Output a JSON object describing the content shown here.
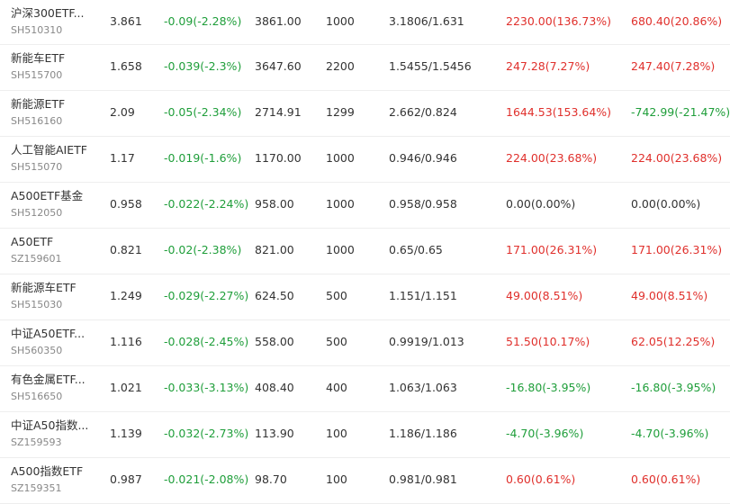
{
  "colors": {
    "up": "#e0302c",
    "down": "#1f9e3a",
    "flat": "#333333"
  },
  "rows": [
    {
      "name": "沪深300ETF...",
      "code": "SH510310",
      "price": "3.861",
      "change": "-0.09(-2.28%)",
      "value": "3861.00",
      "qty": "1000",
      "cost": "3.1806/1.631",
      "pnl1": "2230.00(136.73%)",
      "pnl1_dir": "up",
      "pnl2": "680.40(20.86%)",
      "pnl2_dir": "up"
    },
    {
      "name": "新能车ETF",
      "code": "SH515700",
      "price": "1.658",
      "change": "-0.039(-2.3%)",
      "value": "3647.60",
      "qty": "2200",
      "cost": "1.5455/1.5456",
      "pnl1": "247.28(7.27%)",
      "pnl1_dir": "up",
      "pnl2": "247.40(7.28%)",
      "pnl2_dir": "up"
    },
    {
      "name": "新能源ETF",
      "code": "SH516160",
      "price": "2.09",
      "change": "-0.05(-2.34%)",
      "value": "2714.91",
      "qty": "1299",
      "cost": "2.662/0.824",
      "pnl1": "1644.53(153.64%)",
      "pnl1_dir": "up",
      "pnl2": "-742.99(-21.47%)",
      "pnl2_dir": "down"
    },
    {
      "name": "人工智能AIETF",
      "code": "SH515070",
      "price": "1.17",
      "change": "-0.019(-1.6%)",
      "value": "1170.00",
      "qty": "1000",
      "cost": "0.946/0.946",
      "pnl1": "224.00(23.68%)",
      "pnl1_dir": "up",
      "pnl2": "224.00(23.68%)",
      "pnl2_dir": "up"
    },
    {
      "name": "A500ETF基金",
      "code": "SH512050",
      "price": "0.958",
      "change": "-0.022(-2.24%)",
      "value": "958.00",
      "qty": "1000",
      "cost": "0.958/0.958",
      "pnl1": "0.00(0.00%)",
      "pnl1_dir": "flat",
      "pnl2": "0.00(0.00%)",
      "pnl2_dir": "flat"
    },
    {
      "name": "A50ETF",
      "code": "SZ159601",
      "price": "0.821",
      "change": "-0.02(-2.38%)",
      "value": "821.00",
      "qty": "1000",
      "cost": "0.65/0.65",
      "pnl1": "171.00(26.31%)",
      "pnl1_dir": "up",
      "pnl2": "171.00(26.31%)",
      "pnl2_dir": "up"
    },
    {
      "name": "新能源车ETF",
      "code": "SH515030",
      "price": "1.249",
      "change": "-0.029(-2.27%)",
      "value": "624.50",
      "qty": "500",
      "cost": "1.151/1.151",
      "pnl1": "49.00(8.51%)",
      "pnl1_dir": "up",
      "pnl2": "49.00(8.51%)",
      "pnl2_dir": "up"
    },
    {
      "name": "中证A50ETF...",
      "code": "SH560350",
      "price": "1.116",
      "change": "-0.028(-2.45%)",
      "value": "558.00",
      "qty": "500",
      "cost": "0.9919/1.013",
      "pnl1": "51.50(10.17%)",
      "pnl1_dir": "up",
      "pnl2": "62.05(12.25%)",
      "pnl2_dir": "up"
    },
    {
      "name": "有色金属ETF...",
      "code": "SH516650",
      "price": "1.021",
      "change": "-0.033(-3.13%)",
      "value": "408.40",
      "qty": "400",
      "cost": "1.063/1.063",
      "pnl1": "-16.80(-3.95%)",
      "pnl1_dir": "down",
      "pnl2": "-16.80(-3.95%)",
      "pnl2_dir": "down"
    },
    {
      "name": "中证A50指数...",
      "code": "SZ159593",
      "price": "1.139",
      "change": "-0.032(-2.73%)",
      "value": "113.90",
      "qty": "100",
      "cost": "1.186/1.186",
      "pnl1": "-4.70(-3.96%)",
      "pnl1_dir": "down",
      "pnl2": "-4.70(-3.96%)",
      "pnl2_dir": "down"
    },
    {
      "name": "A500指数ETF",
      "code": "SZ159351",
      "price": "0.987",
      "change": "-0.021(-2.08%)",
      "value": "98.70",
      "qty": "100",
      "cost": "0.981/0.981",
      "pnl1": "0.60(0.61%)",
      "pnl1_dir": "up",
      "pnl2": "0.60(0.61%)",
      "pnl2_dir": "up"
    }
  ]
}
